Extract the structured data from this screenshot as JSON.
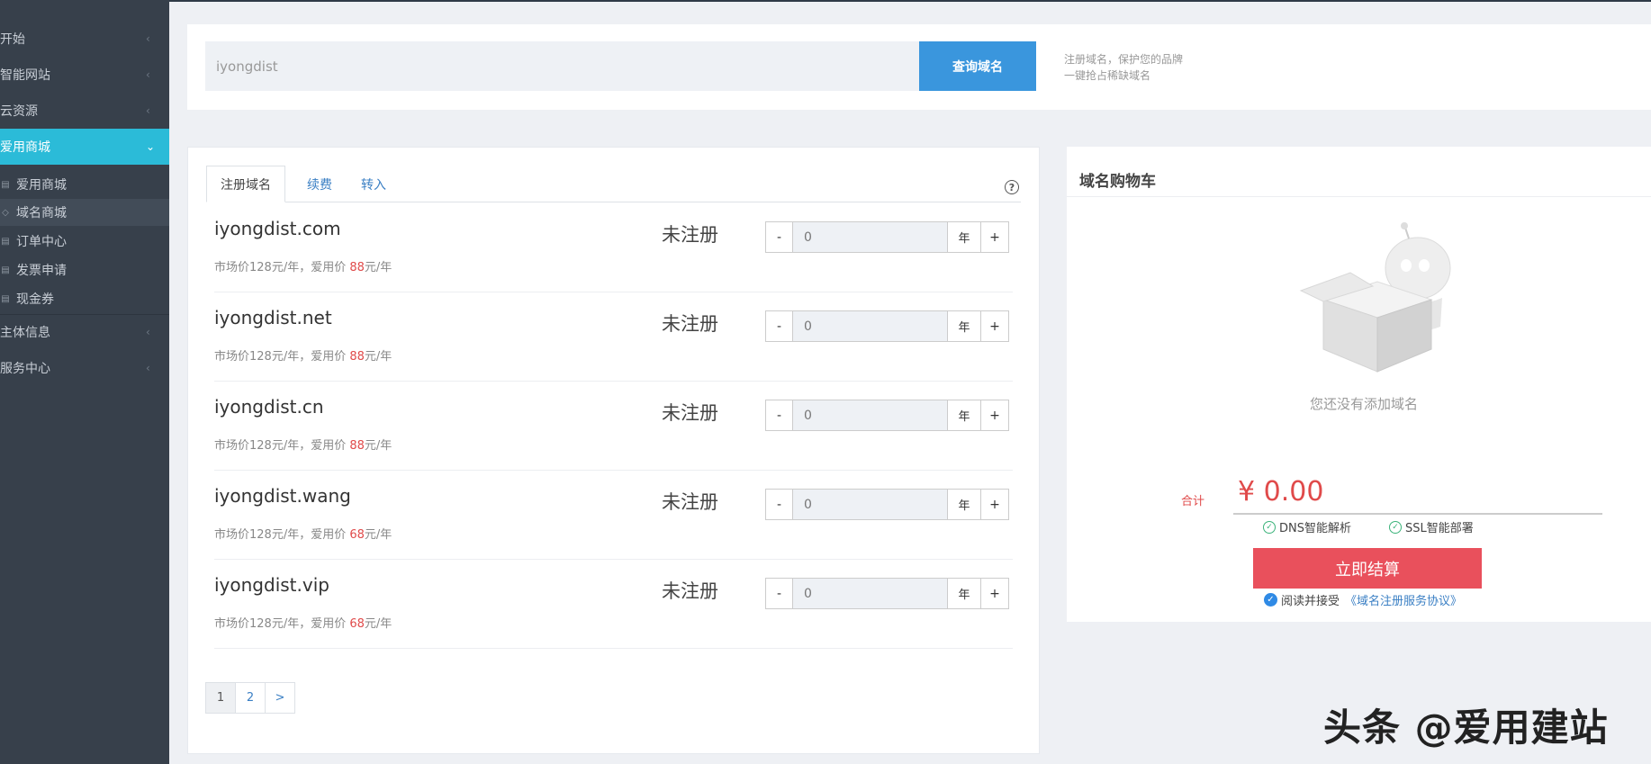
{
  "sidebar": {
    "items": [
      {
        "label": "开始"
      },
      {
        "label": "智能网站"
      },
      {
        "label": "云资源"
      },
      {
        "label": "爱用商城"
      },
      {
        "label": "主体信息"
      },
      {
        "label": "服务中心"
      }
    ],
    "subitems": [
      {
        "label": "爱用商城",
        "icon": "cart-icon"
      },
      {
        "label": "域名商城",
        "icon": "diamond-icon"
      },
      {
        "label": "订单中心",
        "icon": "document-icon"
      },
      {
        "label": "发票申请",
        "icon": "invoice-icon"
      },
      {
        "label": "现金券",
        "icon": "coupon-icon"
      }
    ]
  },
  "search": {
    "value": "iyongdist",
    "button": "查询域名",
    "tip_line1": "注册域名，保护您的品牌",
    "tip_line2": "一键抢占稀缺域名"
  },
  "tabs": [
    "注册域名",
    "续费",
    "转入"
  ],
  "help": "?",
  "domains": [
    {
      "name": "iyongdist.com",
      "status": "未注册",
      "market": "市场价128元/年，爱用价 ",
      "price": "88",
      "suffix": "元/年",
      "qty": "0",
      "unit": "年"
    },
    {
      "name": "iyongdist.net",
      "status": "未注册",
      "market": "市场价128元/年，爱用价 ",
      "price": "88",
      "suffix": "元/年",
      "qty": "0",
      "unit": "年"
    },
    {
      "name": "iyongdist.cn",
      "status": "未注册",
      "market": "市场价128元/年，爱用价 ",
      "price": "88",
      "suffix": "元/年",
      "qty": "0",
      "unit": "年"
    },
    {
      "name": "iyongdist.wang",
      "status": "未注册",
      "market": "市场价128元/年，爱用价 ",
      "price": "68",
      "suffix": "元/年",
      "qty": "0",
      "unit": "年"
    },
    {
      "name": "iyongdist.vip",
      "status": "未注册",
      "market": "市场价128元/年，爱用价 ",
      "price": "68",
      "suffix": "元/年",
      "qty": "0",
      "unit": "年"
    }
  ],
  "stepper": {
    "minus": "-",
    "plus": "+"
  },
  "pager": [
    "1",
    "2",
    ">"
  ],
  "cart": {
    "title": "域名购物车",
    "empty": "您还没有添加域名",
    "total_label": "合计",
    "total_value": "¥ 0.00",
    "features": [
      "DNS智能解析",
      "SSL智能部署"
    ],
    "checkout": "立即结算",
    "agree_text": "阅读并接受",
    "agree_link": "《域名注册服务协议》"
  },
  "watermark": "头条 @爱用建站",
  "colors": {
    "accent": "#2bbbd8",
    "primary": "#3a96dd",
    "danger": "#e9505c",
    "sidebar": "#37404b"
  }
}
